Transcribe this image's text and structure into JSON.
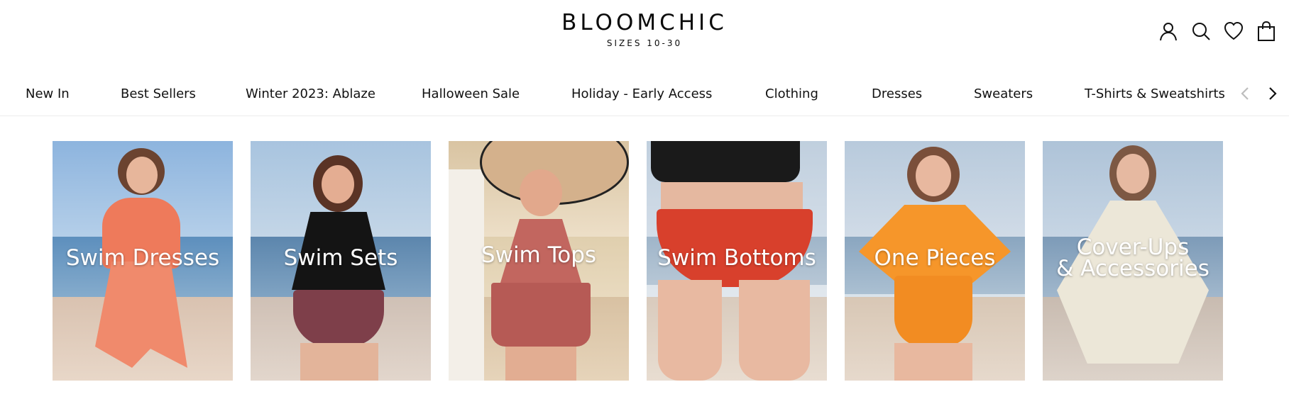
{
  "brand": {
    "name": "BLOOMCHIC",
    "tagline": "SIZES 10-30"
  },
  "header_icons": [
    "account-icon",
    "search-icon",
    "wishlist-heart-icon",
    "shopping-bag-icon"
  ],
  "nav": {
    "items": [
      "New In",
      "Best Sellers",
      "Winter 2023: Ablaze",
      "Halloween Sale",
      "Holiday - Early Access",
      "Clothing",
      "Dresses",
      "Sweaters",
      "T-Shirts & Sweatshirts"
    ]
  },
  "categories": [
    {
      "label": "Swim Dresses",
      "colors": {
        "garment": "#ef7a5c"
      }
    },
    {
      "label": "Swim Sets",
      "colors": {
        "garment": "#141414"
      }
    },
    {
      "label": "Swim Tops",
      "colors": {
        "garment": "#c2665f"
      }
    },
    {
      "label": "Swim Bottoms",
      "colors": {
        "garment": "#d8402c"
      }
    },
    {
      "label": "One Pieces",
      "colors": {
        "garment": "#f6962a"
      }
    },
    {
      "label_line1": "Cover-Ups",
      "label_line2": "& Accessories",
      "colors": {
        "garment": "#ece7d8"
      }
    }
  ],
  "colors": {
    "text": "#111111",
    "arrow_disabled": "#bdbdbd",
    "divider": "#ececec",
    "sky": "#9fc1e2",
    "sea": "#5f8cb5",
    "sand": "#d8c3ae"
  }
}
